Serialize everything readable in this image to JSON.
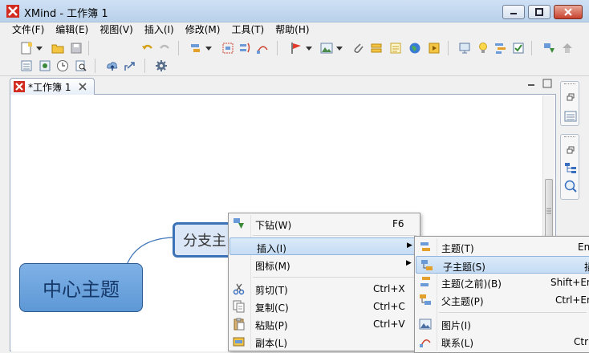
{
  "window": {
    "title": "XMind - 工作簿 1"
  },
  "menubar": [
    "文件(F)",
    "编辑(E)",
    "视图(V)",
    "插入(I)",
    "修改(M)",
    "工具(T)",
    "帮助(H)"
  ],
  "editor": {
    "tab_label": "*工作簿 1"
  },
  "topics": {
    "central": "中心主题",
    "branch": "分支主"
  },
  "context_menu": {
    "items": [
      {
        "label": "下钻(W)",
        "shortcut": "F6"
      },
      {
        "label": "插入(I)",
        "submenu": true
      },
      {
        "label": "图标(M)",
        "submenu": true
      },
      {
        "label": "剪切(T)",
        "shortcut": "Ctrl+X"
      },
      {
        "label": "复制(C)",
        "shortcut": "Ctrl+C"
      },
      {
        "label": "粘贴(P)",
        "shortcut": "Ctrl+V"
      },
      {
        "label": "副本(L)",
        "shortcut": ""
      }
    ]
  },
  "insert_submenu": {
    "items": [
      {
        "label": "主题(T)",
        "shortcut": "En"
      },
      {
        "label": "子主题(S)",
        "shortcut": "插"
      },
      {
        "label": "主题(之前)(B)",
        "shortcut": "Shift+En"
      },
      {
        "label": "父主题(P)",
        "shortcut": "Ctrl+En"
      },
      {
        "label": "图片(I)",
        "shortcut": ""
      },
      {
        "label": "联系(L)",
        "shortcut": "Ctrl"
      }
    ]
  },
  "colors": {
    "accent": "#3c72b8",
    "central_fill": "#6aa3de",
    "branch_fill": "#dbe7f7",
    "flag": "#e23b2c"
  }
}
